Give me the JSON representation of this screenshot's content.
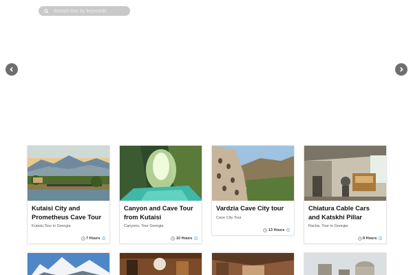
{
  "search": {
    "placeholder": "Search tour by keywords",
    "icon": "search-icon"
  },
  "carousel": {
    "prev_icon": "chevron-left-icon",
    "next_icon": "chevron-right-icon"
  },
  "tours": [
    {
      "title": "Kutaisi City and Prometheus Cave Tour",
      "subtitle": "Kutaisi,Tour in Georgia",
      "duration": "7 Hours"
    },
    {
      "title": "Canyon and Cave Tour from Kutaisi",
      "subtitle": "Canyons, Tour Georgia",
      "duration": "10 Hours"
    },
    {
      "title": "Vardzia Cave City tour",
      "subtitle": "Cave City Tour",
      "duration": "13 Hours"
    },
    {
      "title": "Chiatura Cable Cars and Katskhi Pillar",
      "subtitle": "Racha, Tour in Georgia",
      "duration": "9 Hours"
    }
  ],
  "colors": {
    "search_bg": "#c9c9c9",
    "arrow_bg": "#6e6e6e",
    "info_blue": "#4a90d9"
  }
}
